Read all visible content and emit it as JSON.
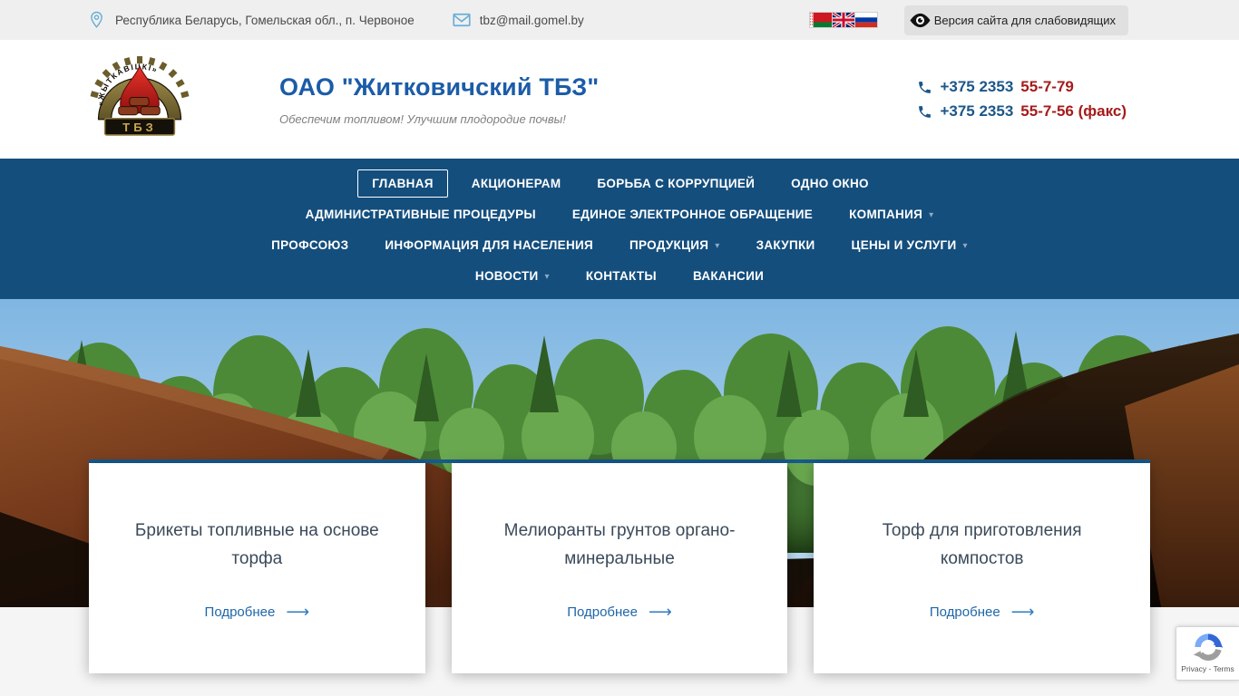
{
  "topbar": {
    "address": "Республика Беларусь, Гомельская обл., п. Червоное",
    "email": "tbz@mail.gomel.by",
    "languages": [
      {
        "id": "belarusian-flag",
        "title": "Белорусский"
      },
      {
        "id": "english-flag",
        "title": "English"
      },
      {
        "id": "russian-flag",
        "title": "Русский"
      }
    ],
    "accessibility_label": "Версия сайта для слабовидящих"
  },
  "header": {
    "company_name": "ОАО \"Житковичский ТБЗ\"",
    "slogan": "Обеспечим топливом! Улучшим плодородие почвы!",
    "phones": [
      {
        "code": "+375 2353",
        "number": "55-7-79"
      },
      {
        "code": "+375 2353",
        "number": "55-7-56 (факс)"
      }
    ]
  },
  "logo": {
    "arch_text": "«ЖЫТКАВІЦКІ»",
    "plate_text": "ТБЗ"
  },
  "nav": {
    "rows": [
      [
        {
          "label": "ГЛАВНАЯ",
          "active": true
        },
        {
          "label": "АКЦИОНЕРАМ"
        },
        {
          "label": "БОРЬБА С КОРРУПЦИЕЙ"
        },
        {
          "label": "ОДНО ОКНО"
        }
      ],
      [
        {
          "label": "АДМИНИСТРАТИВНЫЕ ПРОЦЕДУРЫ"
        },
        {
          "label": "ЕДИНОЕ ЭЛЕКТРОННОЕ ОБРАЩЕНИЕ"
        },
        {
          "label": "КОМПАНИЯ",
          "dropdown": true
        }
      ],
      [
        {
          "label": "ПРОФСОЮЗ"
        },
        {
          "label": "ИНФОРМАЦИЯ ДЛЯ НАСЕЛЕНИЯ"
        },
        {
          "label": "ПРОДУКЦИЯ",
          "dropdown": true
        },
        {
          "label": "ЗАКУПКИ"
        },
        {
          "label": "ЦЕНЫ И УСЛУГИ",
          "dropdown": true
        }
      ],
      [
        {
          "label": "НОВОСТИ",
          "dropdown": true
        },
        {
          "label": "КОНТАКТЫ"
        },
        {
          "label": "ВАКАНСИИ"
        }
      ]
    ]
  },
  "slider": {
    "cards": [
      {
        "title": "Брикеты топливные на основе торфа",
        "link_label": "Подробнее"
      },
      {
        "title": "Мелиоранты грунтов органо-минеральные",
        "link_label": "Подробнее"
      },
      {
        "title": "Торф для приготовления компостов",
        "link_label": "Подробнее"
      }
    ]
  },
  "recaptcha": {
    "privacy_terms": "Privacy - Terms"
  },
  "icons": {
    "dropdown_caret": "▾",
    "arrow_right": "⟶"
  },
  "colors": {
    "brand_blue": "#1b5ca8",
    "nav_blue": "#144e7d",
    "phone_red": "#a61b1b",
    "link_blue": "#1f66a8",
    "card_top_border": "#175a8e",
    "topbar_bg": "#efefef",
    "icon_light_blue": "#6aaed6"
  }
}
